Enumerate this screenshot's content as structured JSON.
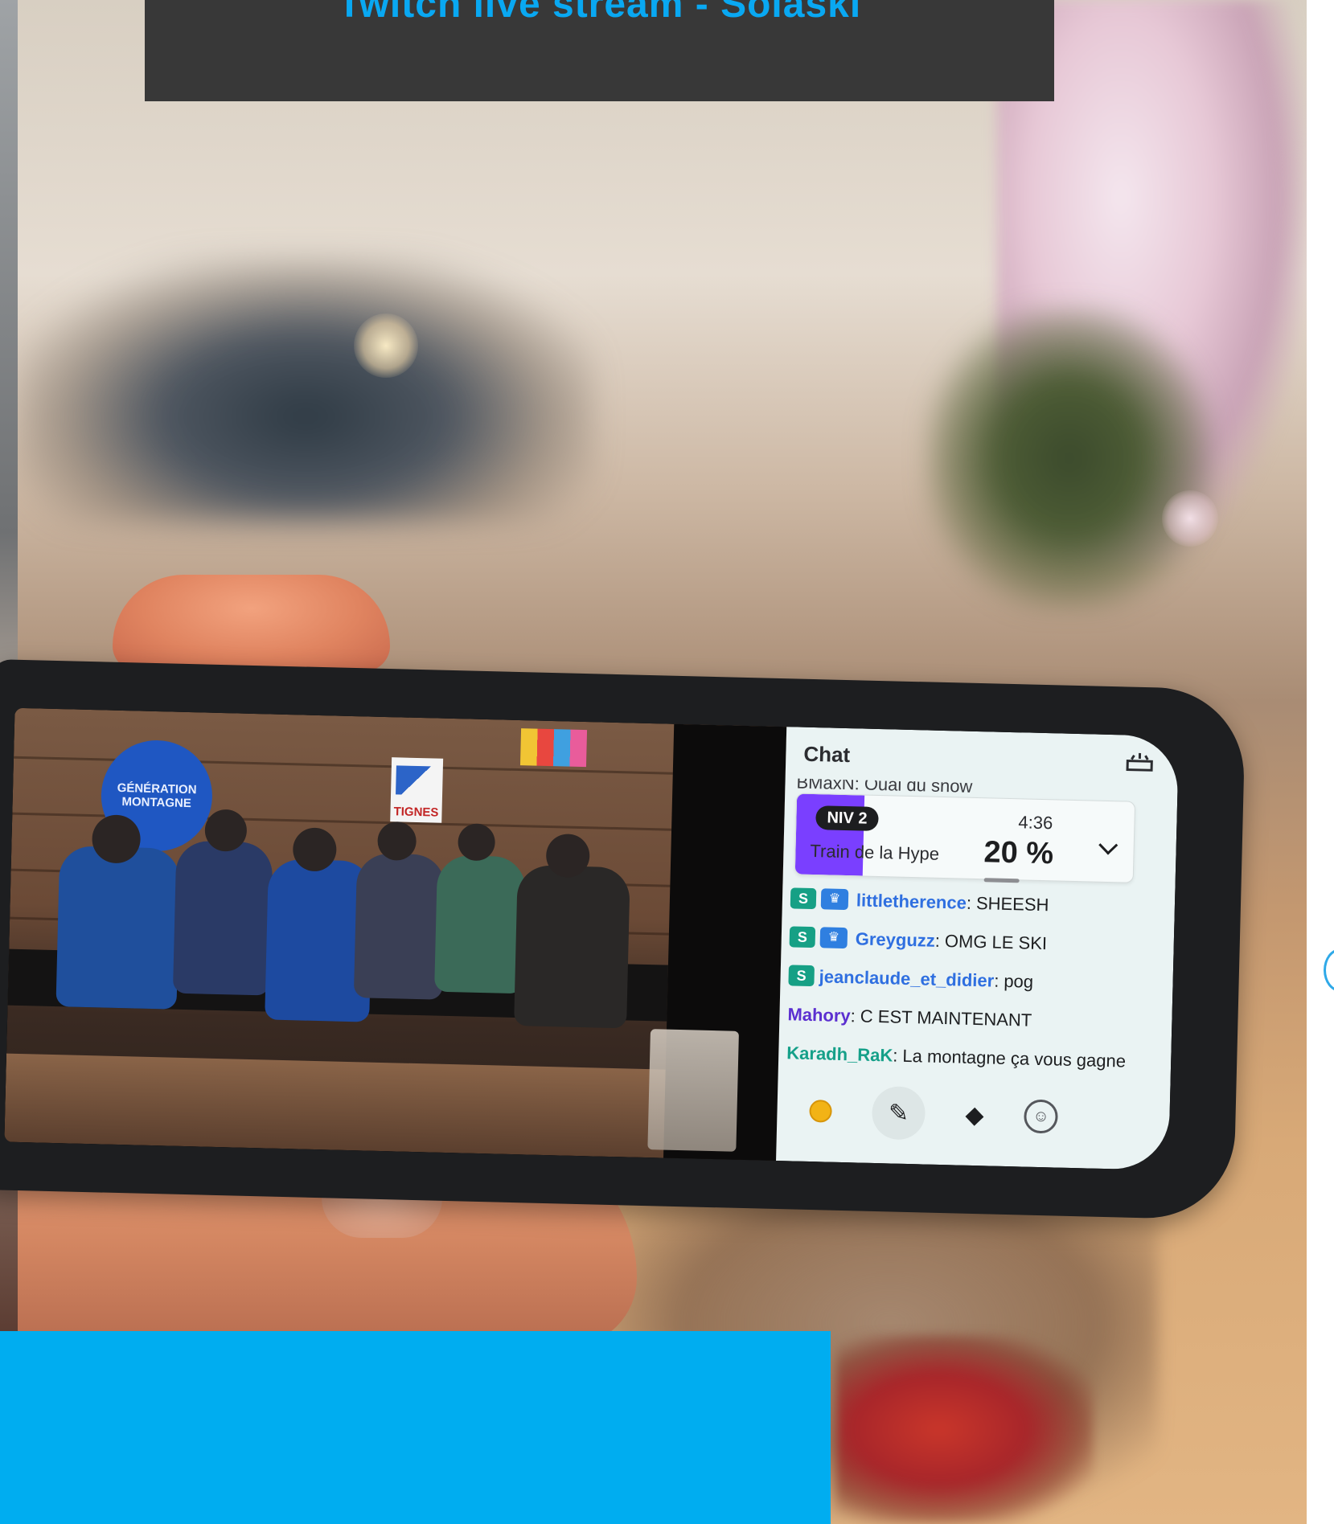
{
  "title": "Twitch live stream - Solaski",
  "video": {
    "banner_left": "GÉNÉRATION MONTAGNE",
    "banner_right": "TIGNES"
  },
  "chat": {
    "header": "Chat",
    "clipped_message": "BMaxN: Ouai du snow",
    "hype_train": {
      "level": "NIV 2",
      "label": "Train de la Hype",
      "timer": "4:36",
      "percent_text": "20 %",
      "progress": 0.2
    },
    "messages": [
      {
        "user": "littletherence",
        "text": "SHEESH",
        "color": "#2f6fe0",
        "sub": true,
        "crown": true
      },
      {
        "user": "Greyguzz",
        "text": "OMG LE SKI",
        "color": "#2f6fe0",
        "sub": true,
        "crown": true
      },
      {
        "user": "jeanclaude_et_didier",
        "text": "pog",
        "color": "#2f6fe0",
        "sub": true,
        "crown": false
      },
      {
        "user": "Mahory",
        "text": "C EST MAINTENANT",
        "color": "#5b2fd0",
        "sub": false,
        "crown": false
      },
      {
        "user": "Karadh_RaK",
        "text": "La montagne ça vous gagne",
        "color": "#15a089",
        "sub": false,
        "crown": false
      }
    ],
    "toolbar": {
      "coin_icon": "coin-icon",
      "pen_icon": "pen-icon",
      "drop_icon": "diamond-icon",
      "emoji_icon": "emoji-icon"
    }
  },
  "colors": {
    "title_text": "#09a8f2",
    "title_bg": "#383838",
    "accent_block": "#00adf0",
    "hype_fill": "#7a3fff"
  }
}
